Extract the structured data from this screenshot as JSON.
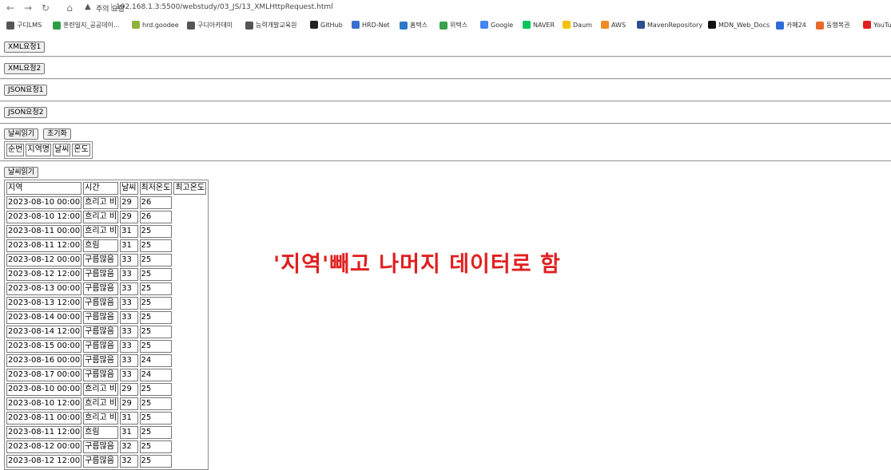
{
  "browser": {
    "warning": "주의 요함",
    "url": "192.168.1.3:5500/webstudy/03_JS/13_XMLHttpRequest.html",
    "bookmarks": [
      {
        "label": "구디LMS",
        "color": "#555555"
      },
      {
        "label": "훈련일지_공공데이...",
        "color": "#2e9e44"
      },
      {
        "label": "hrd.goodee",
        "color": "#8fb33a"
      },
      {
        "label": "구디아카데미",
        "color": "#555555"
      },
      {
        "label": "능력개발교육원",
        "color": "#555555"
      },
      {
        "label": "GitHub",
        "color": "#222222"
      },
      {
        "label": "HRD-Net",
        "color": "#3a6fd0"
      },
      {
        "label": "홈택스",
        "color": "#2a7ac9"
      },
      {
        "label": "위택스",
        "color": "#3aa04a"
      },
      {
        "label": "Google",
        "color": "#4285f4"
      },
      {
        "label": "NAVER",
        "color": "#03c75a"
      },
      {
        "label": "Daum",
        "color": "#f4c20d"
      },
      {
        "label": "AWS",
        "color": "#f08a24"
      },
      {
        "label": "MavenRepository",
        "color": "#2b4f8f"
      },
      {
        "label": "MDN_Web_Docs",
        "color": "#111111"
      },
      {
        "label": "카페24",
        "color": "#2f6ad8"
      },
      {
        "label": "동행복권",
        "color": "#e86a2a"
      },
      {
        "label": "YouTu",
        "color": "#e02020"
      }
    ]
  },
  "page": {
    "btn_xml1": "XML요청1",
    "btn_xml2": "XML요청2",
    "btn_json1": "JSON요청1",
    "btn_json2": "JSON요청2",
    "btn_weather_read": "날씨읽기",
    "btn_reset": "초기화",
    "btn_weather_read2": "날씨읽기",
    "table1_headers": [
      "순번",
      "지역명",
      "날씨",
      "온도"
    ],
    "table2_headers": [
      "지역",
      "시간",
      "날씨",
      "최저온도",
      "최고온도"
    ],
    "table2_rows": [
      [
        "2023-08-10 00:00",
        "흐리고 비",
        "29",
        "26"
      ],
      [
        "2023-08-10 12:00",
        "흐리고 비",
        "29",
        "26"
      ],
      [
        "2023-08-11 00:00",
        "흐리고 비",
        "31",
        "25"
      ],
      [
        "2023-08-11 12:00",
        "흐림",
        "31",
        "25"
      ],
      [
        "2023-08-12 00:00",
        "구름많음",
        "33",
        "25"
      ],
      [
        "2023-08-12 12:00",
        "구름많음",
        "33",
        "25"
      ],
      [
        "2023-08-13 00:00",
        "구름많음",
        "33",
        "25"
      ],
      [
        "2023-08-13 12:00",
        "구름많음",
        "33",
        "25"
      ],
      [
        "2023-08-14 00:00",
        "구름많음",
        "33",
        "25"
      ],
      [
        "2023-08-14 12:00",
        "구름많음",
        "33",
        "25"
      ],
      [
        "2023-08-15 00:00",
        "구름많음",
        "33",
        "25"
      ],
      [
        "2023-08-16 00:00",
        "구름많음",
        "33",
        "24"
      ],
      [
        "2023-08-17 00:00",
        "구름많음",
        "33",
        "24"
      ],
      [
        "2023-08-10 00:00",
        "흐리고 비",
        "29",
        "25"
      ],
      [
        "2023-08-10 12:00",
        "흐리고 비",
        "29",
        "25"
      ],
      [
        "2023-08-11 00:00",
        "흐리고 비",
        "31",
        "25"
      ],
      [
        "2023-08-11 12:00",
        "흐림",
        "31",
        "25"
      ],
      [
        "2023-08-12 00:00",
        "구름많음",
        "32",
        "25"
      ],
      [
        "2023-08-12 12:00",
        "구름많음",
        "32",
        "25"
      ]
    ],
    "annotation": "'지역'빼고 나머지 데이터로 함"
  }
}
